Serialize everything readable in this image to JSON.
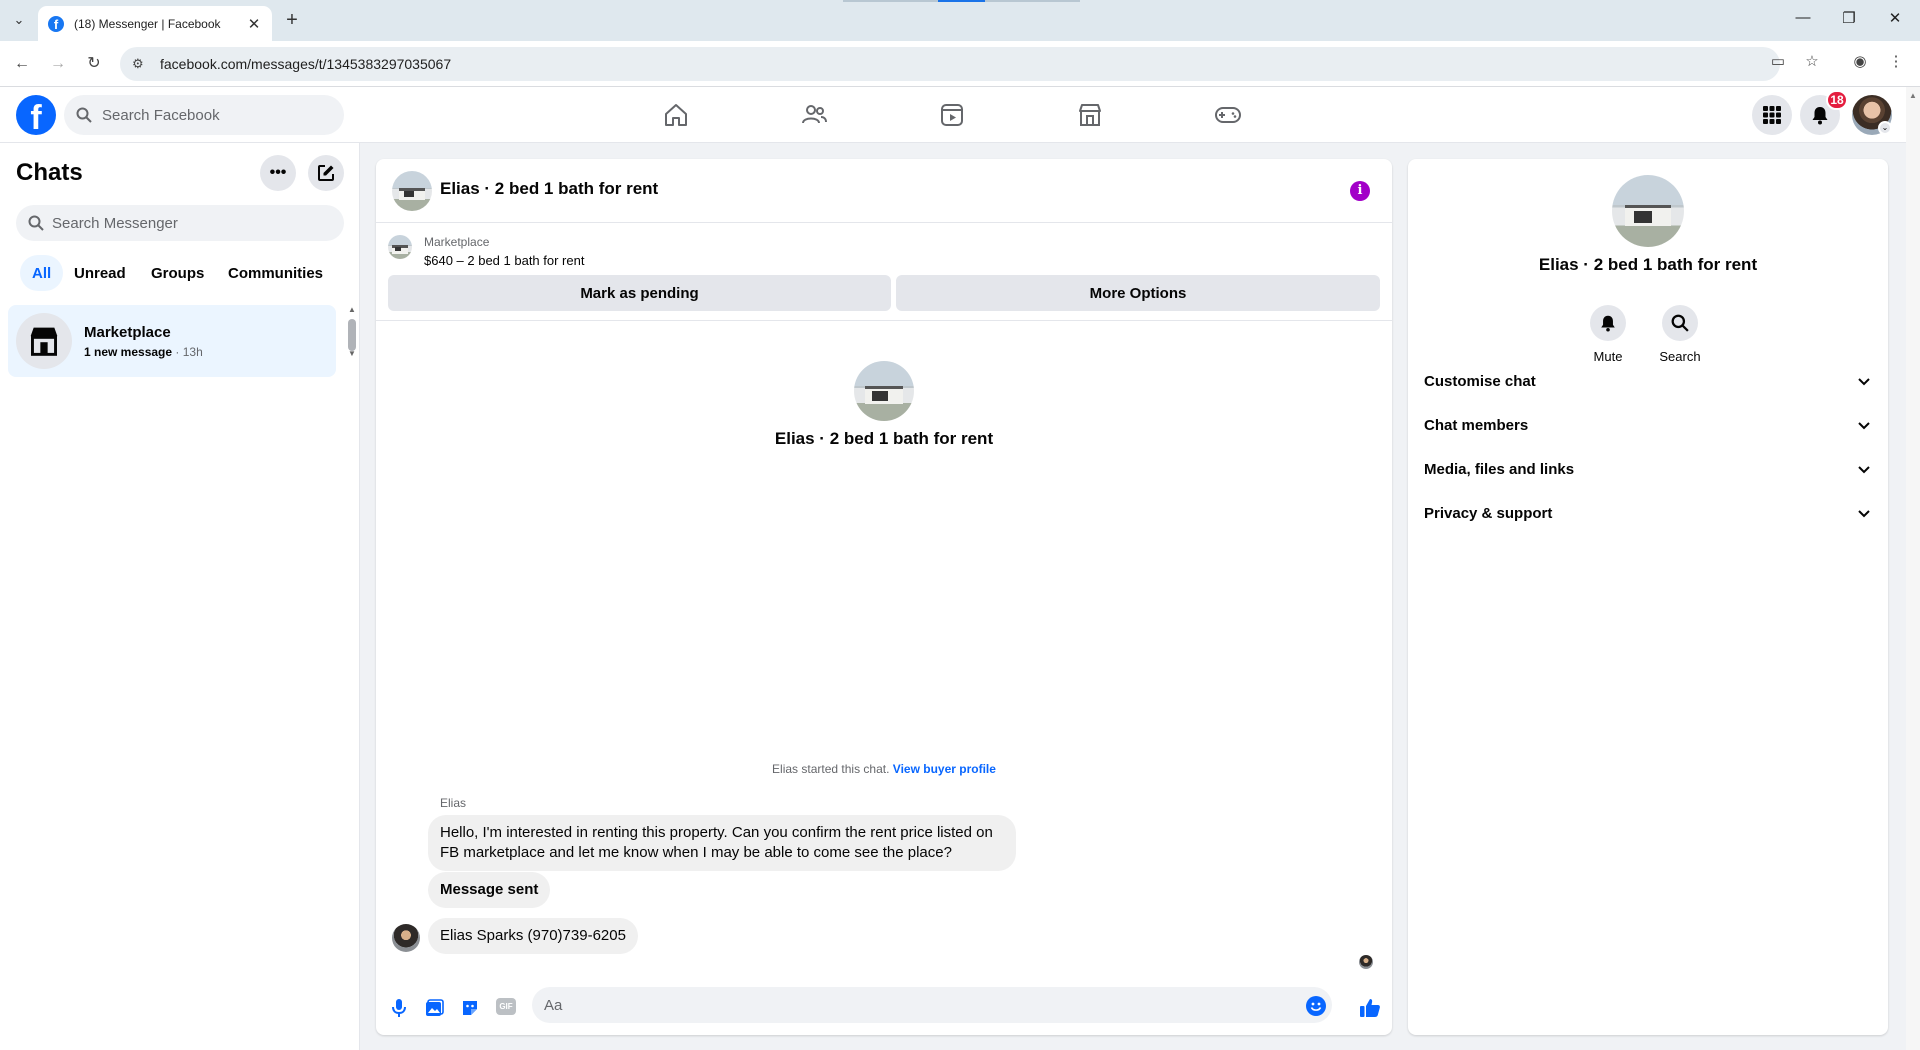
{
  "browser": {
    "tab_title": "(18) Messenger | Facebook",
    "url": "facebook.com/messages/t/1345383297035067"
  },
  "fb": {
    "search_placeholder": "Search Facebook",
    "notification_count": "18",
    "nav_icons": [
      "home-icon",
      "friends-icon",
      "video-icon",
      "marketplace-icon",
      "gaming-icon"
    ]
  },
  "chats": {
    "title": "Chats",
    "search_placeholder": "Search Messenger",
    "filters": [
      "All",
      "Unread",
      "Groups",
      "Communities"
    ],
    "items": [
      {
        "name": "Marketplace",
        "preview": "1 new message",
        "time": "13h"
      }
    ]
  },
  "conversation": {
    "title": "Elias · 2 bed 1 bath for rent",
    "marketplace_label": "Marketplace",
    "listing": "$640 – 2 bed 1 bath for rent",
    "mark_pending": "Mark as pending",
    "more_options": "More Options",
    "intro_name": "Elias · 2 bed 1 bath for rent",
    "started_text": "Elias started this chat.",
    "view_profile": "View buyer profile",
    "sender": "Elias",
    "messages": [
      "Hello, I'm interested in renting this property. Can you confirm the rent price listed on FB marketplace and let me know when I may be able to come see the place?",
      "Message sent",
      "Elias Sparks (970)739-6205"
    ],
    "composer_placeholder": "Aa"
  },
  "info_panel": {
    "name": "Elias · 2 bed 1 bath for rent",
    "actions": [
      "Mute",
      "Search"
    ],
    "sections": [
      "Customise chat",
      "Chat members",
      "Media, files and links",
      "Privacy & support"
    ]
  },
  "colors": {
    "brand_blue": "#0866ff",
    "selected_bg": "#ebf5ff",
    "info_purple": "#a200c8",
    "badge_red": "#e41e3f"
  }
}
